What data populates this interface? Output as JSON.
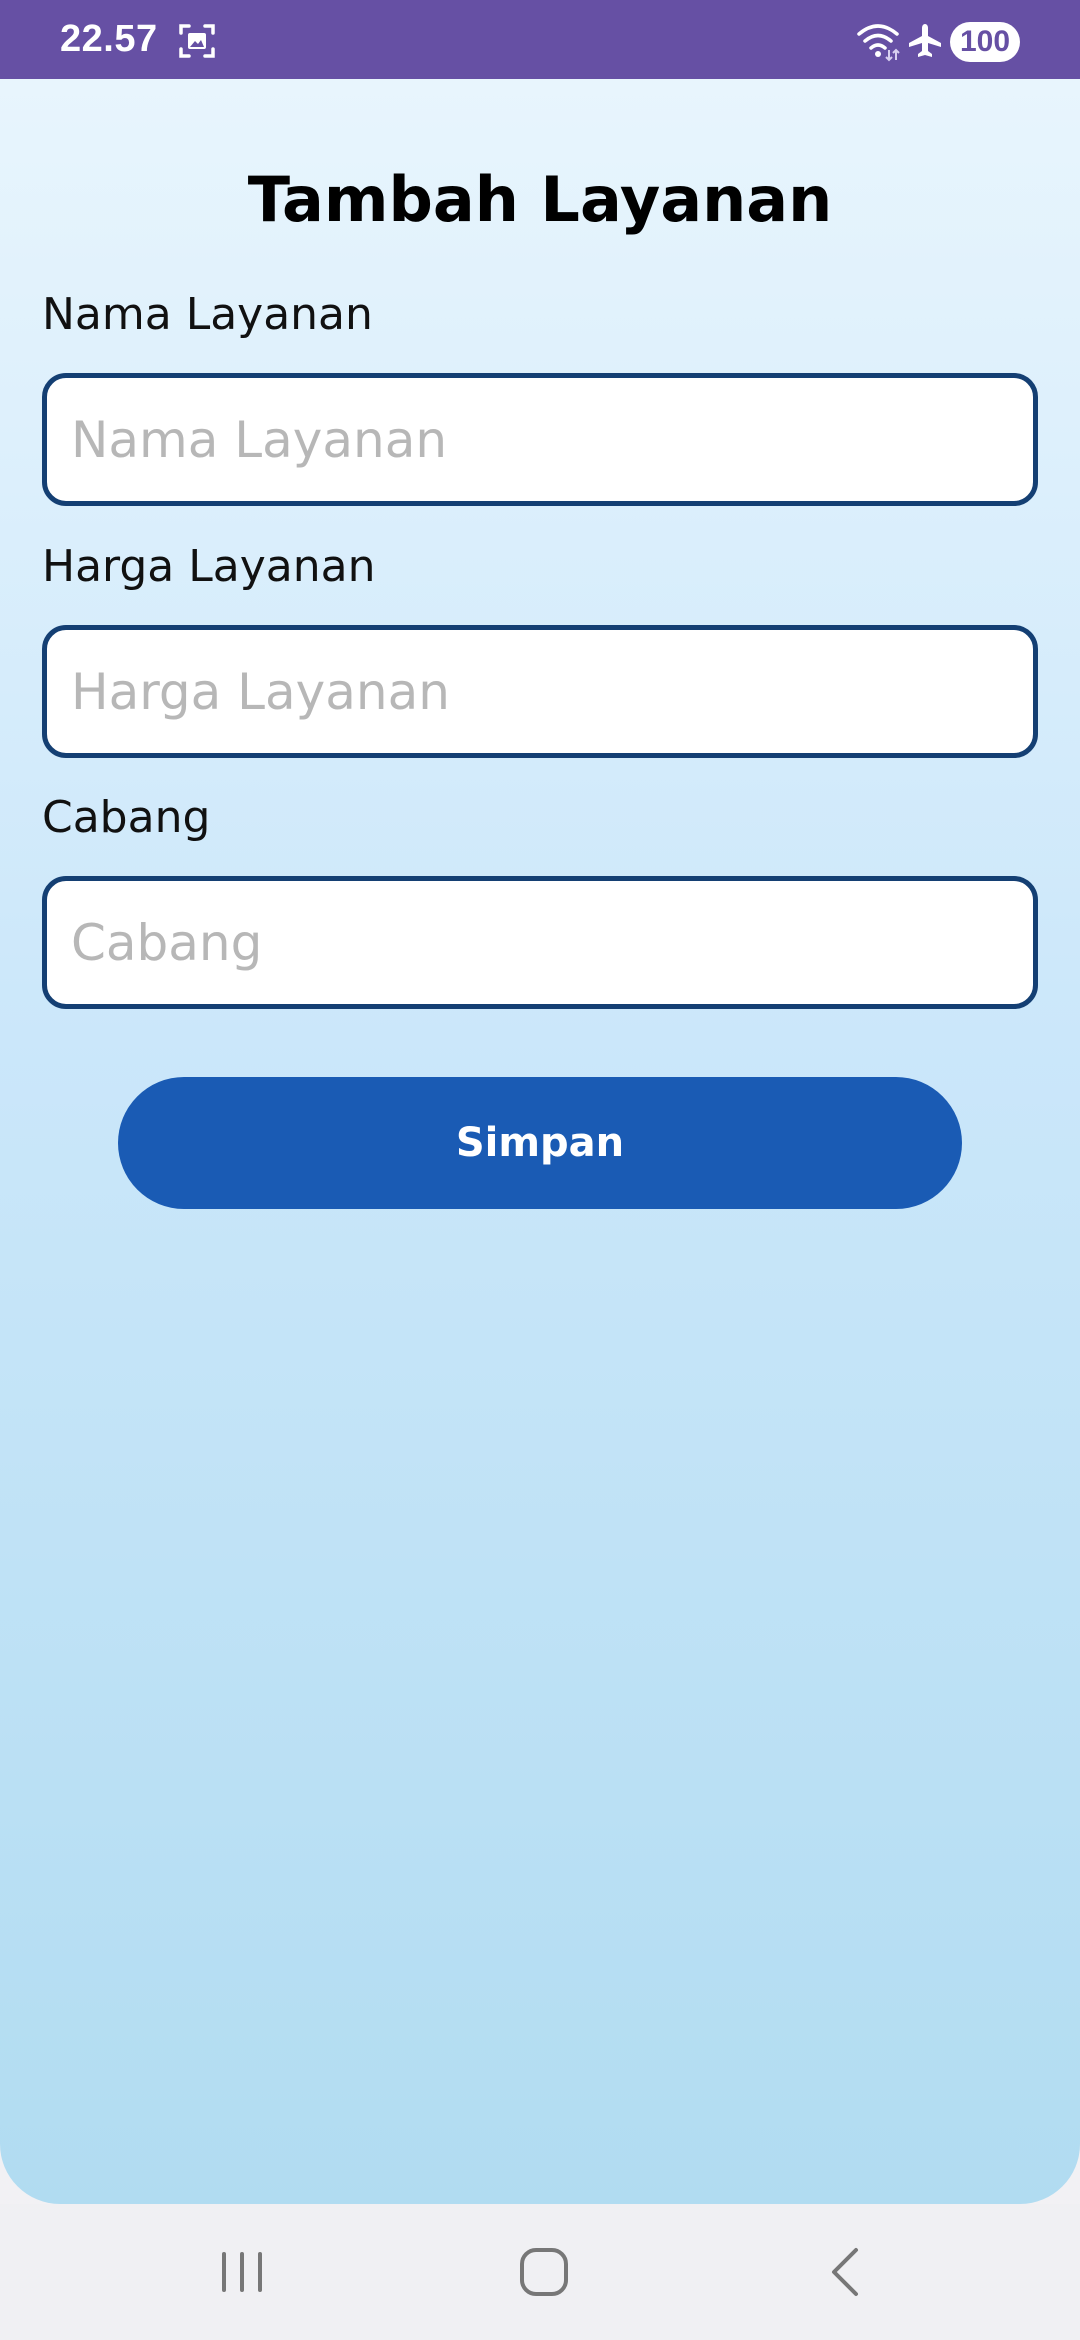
{
  "status_bar": {
    "time": "22.57",
    "battery": "100",
    "background_color": "#6650a4",
    "icons": [
      "screenshot-icon",
      "wifi-icon",
      "airplane-icon",
      "battery-icon"
    ]
  },
  "page": {
    "title": "Tambah Layanan"
  },
  "form": {
    "service_name": {
      "label": "Nama Layanan",
      "placeholder": "Nama Layanan",
      "value": ""
    },
    "service_price": {
      "label": "Harga Layanan",
      "placeholder": "Harga Layanan",
      "value": ""
    },
    "branch": {
      "label": "Cabang",
      "placeholder": "Cabang",
      "value": ""
    },
    "save_label": "Simpan"
  },
  "nav_bar": {
    "icons": [
      "recent-apps-icon",
      "home-icon",
      "back-icon"
    ]
  },
  "colors": {
    "primary_button": "#1a5bb4",
    "input_border": "#143f73",
    "background_top": "#e8f5fd",
    "background_bottom": "#b1dcf1"
  }
}
